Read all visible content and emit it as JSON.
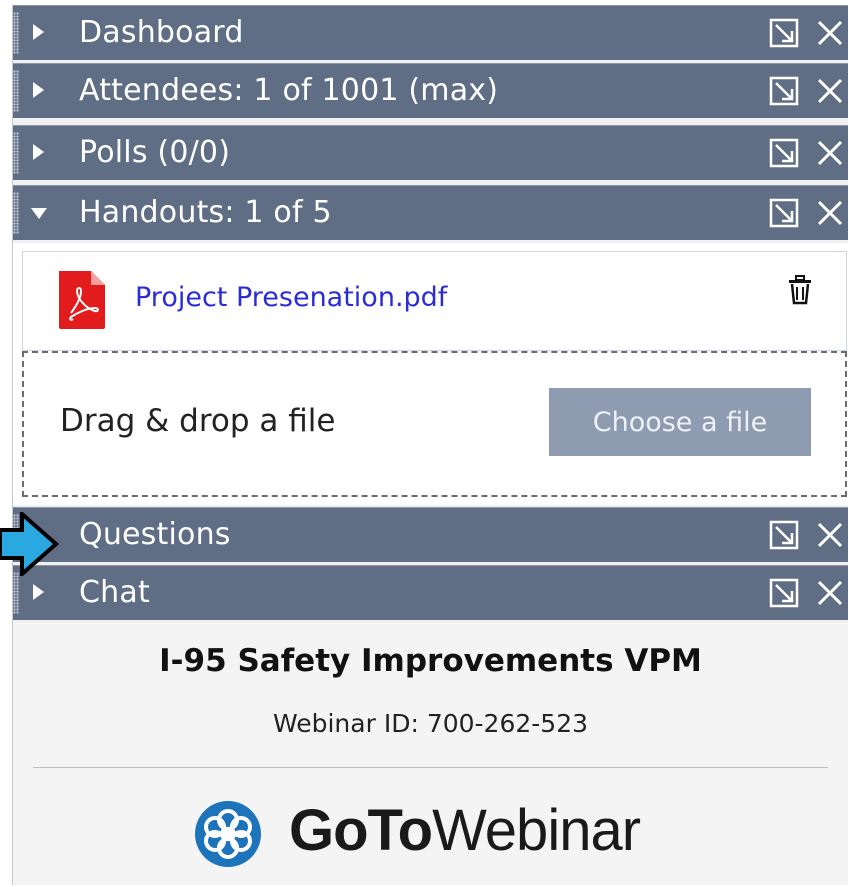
{
  "sections": {
    "dashboard": {
      "label": "Dashboard"
    },
    "attendees": {
      "label": "Attendees:  1 of 1001 (max)"
    },
    "polls": {
      "label": "Polls (0/0)"
    },
    "handouts": {
      "label": "Handouts: 1 of 5"
    },
    "questions": {
      "label": "Questions"
    },
    "chat": {
      "label": "Chat"
    }
  },
  "handouts": {
    "files": [
      {
        "name": "Project Presenation.pdf",
        "icon": "pdf-icon"
      }
    ],
    "drop_label": "Drag & drop a file",
    "choose_button": "Choose a file"
  },
  "webinar": {
    "title": "I-95 Safety Improvements VPM",
    "id_text": "Webinar ID: 700-262-523"
  },
  "logo": {
    "goto": "GoTo",
    "webinar": "Webinar"
  },
  "colors": {
    "bar": "#5f6d85",
    "link": "#2a2dd6",
    "button": "#8f9bb1",
    "callout_arrow": "#2aa8e0"
  }
}
